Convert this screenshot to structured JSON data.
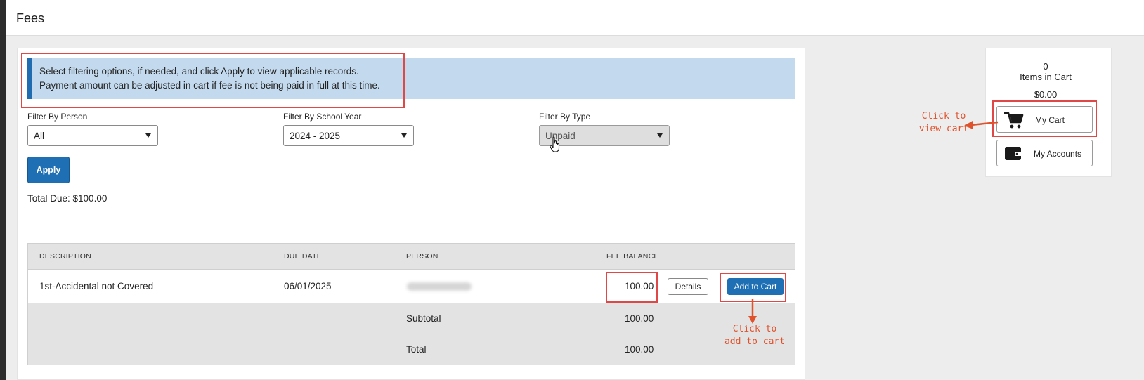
{
  "page": {
    "title": "Fees"
  },
  "info": {
    "line1": "Select filtering options, if needed, and click Apply to view applicable records.",
    "line2": "Payment amount can be adjusted in cart if fee is not being paid in full at this time."
  },
  "filters": {
    "person": {
      "label": "Filter By Person",
      "value": "All"
    },
    "school_year": {
      "label": "Filter By School Year",
      "value": "2024 - 2025"
    },
    "type": {
      "label": "Filter By Type",
      "value": "Unpaid"
    }
  },
  "apply_label": "Apply",
  "total_due": "Total Due: $100.00",
  "table": {
    "headers": {
      "description": "DESCRIPTION",
      "due_date": "DUE DATE",
      "person": "PERSON",
      "fee_balance": "FEE BALANCE"
    },
    "rows": [
      {
        "description": "1st-Accidental not Covered",
        "due_date": "06/01/2025",
        "fee_balance": "100.00",
        "details_label": "Details",
        "add_label": "Add to Cart"
      }
    ],
    "subtotal": {
      "label": "Subtotal",
      "value": "100.00"
    },
    "total": {
      "label": "Total",
      "value": "100.00"
    }
  },
  "cart": {
    "count": "0",
    "items_label": "Items in Cart",
    "amount": "$0.00",
    "my_cart_label": "My Cart",
    "my_accounts_label": "My Accounts"
  },
  "annotations": {
    "view_cart": [
      "Click to",
      "view cart"
    ],
    "add_to_cart": [
      "Click to",
      "add to cart"
    ]
  },
  "colors": {
    "accent": "#1f6fb4",
    "banner": "#c3d9ed",
    "highlight": "#e04848",
    "callout": "#e0522c"
  },
  "icons": [
    "cart-icon",
    "wallet-icon",
    "hand-cursor-icon",
    "caret-down-icon"
  ]
}
